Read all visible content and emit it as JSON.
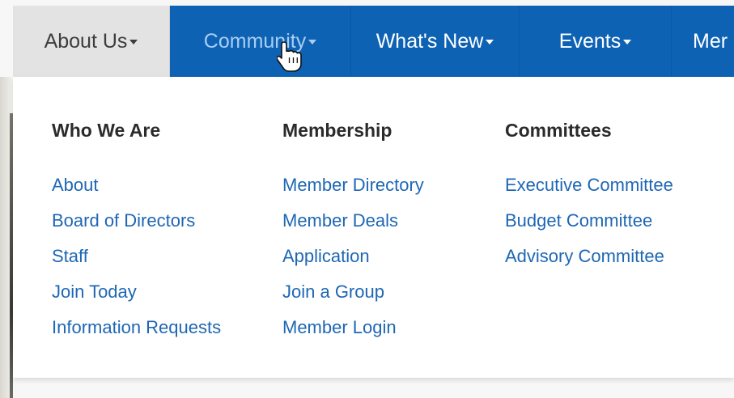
{
  "navbar": {
    "items": [
      {
        "label": "About Us"
      },
      {
        "label": "Community"
      },
      {
        "label": "What's New"
      },
      {
        "label": "Events"
      },
      {
        "label": "Mer"
      }
    ]
  },
  "dropdown": {
    "columns": [
      {
        "heading": "Who We Are",
        "links": [
          "About",
          "Board of Directors",
          "Staff",
          "Join Today",
          "Information Requests"
        ]
      },
      {
        "heading": "Membership",
        "links": [
          "Member Directory",
          "Member Deals",
          "Application",
          "Join a Group",
          "Member Login"
        ]
      },
      {
        "heading": "Committees",
        "links": [
          "Executive Committee",
          "Budget Committee",
          "Advisory Committee"
        ]
      }
    ]
  },
  "colors": {
    "nav_bg": "#0e62b4",
    "nav_active_bg": "#e3e3e3",
    "link": "#1e67b4",
    "heading": "#2b2b2b"
  },
  "icons": {
    "cursor": "hand-pointer-icon",
    "caret": "caret-down-icon"
  }
}
